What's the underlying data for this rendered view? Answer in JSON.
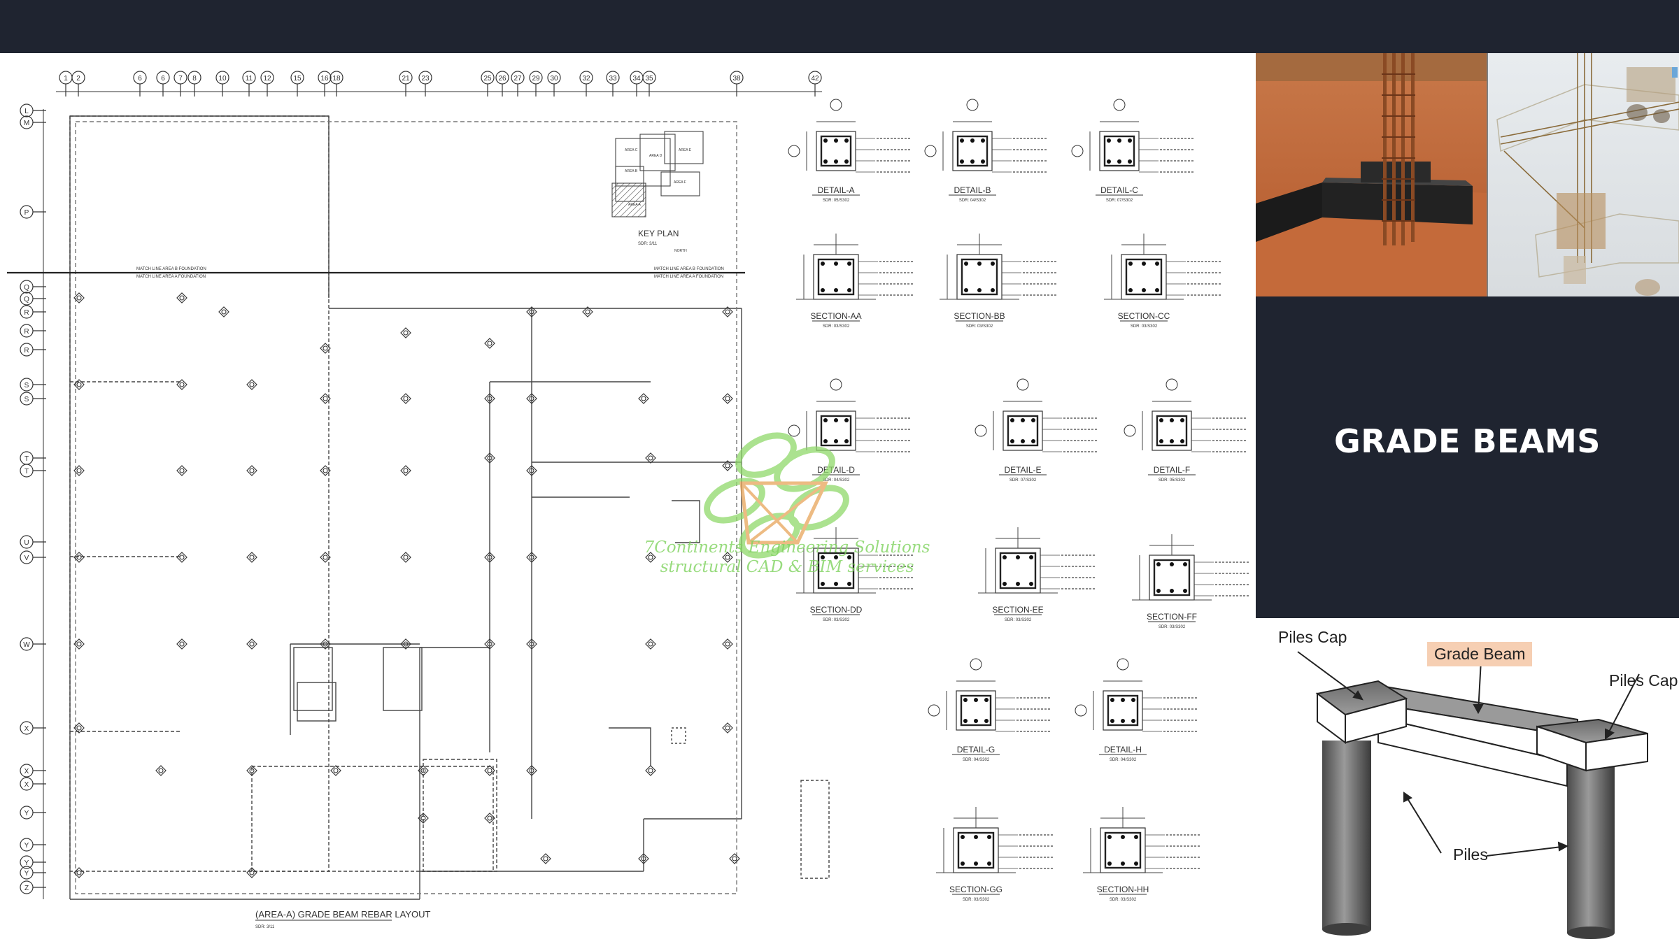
{
  "title": "GRADE BEAMS",
  "plan": {
    "top_grid_labels": [
      "1",
      "2",
      "6",
      "6",
      "7",
      "8",
      "10",
      "11",
      "12",
      "15",
      "16",
      "18",
      "21",
      "23",
      "25",
      "26",
      "27",
      "29",
      "30",
      "32",
      "33",
      "34",
      "35",
      "38",
      "42"
    ],
    "left_grid_labels": [
      "L",
      "M",
      "P",
      "Q",
      "Q",
      "R",
      "R",
      "R",
      "S",
      "S",
      "T",
      "T",
      "U",
      "V",
      "W",
      "X",
      "X",
      "X",
      "Y",
      "Y",
      "Y",
      "Y",
      "Z"
    ],
    "key_plan": {
      "title": "KEY PLAN",
      "ref": "SDR: 3/11",
      "areas": [
        "AREA C",
        "AREA D",
        "AREA E",
        "AREA B",
        "AREA F",
        "AREA A"
      ],
      "north": "NORTH"
    },
    "match_line_left": [
      "MATCH LINE AREA B FOUNDATION",
      "MATCH LINE AREA A FOUNDATION"
    ],
    "match_line_right": [
      "MATCH LINE AREA B FOUNDATION",
      "MATCH LINE AREA A FOUNDATION"
    ],
    "caption": "(AREA-A) GRADE BEAM REBAR LAYOUT",
    "caption_ref": "SDR: 3/11"
  },
  "details": [
    {
      "name": "DETAIL-A",
      "ref": "SDR: 05/S302"
    },
    {
      "name": "DETAIL-B",
      "ref": "SDR: 04/S302"
    },
    {
      "name": "DETAIL-C",
      "ref": "SDR: 07/S302"
    },
    {
      "name": "SECTION-AA",
      "ref": "SDR: 03/S302"
    },
    {
      "name": "SECTION-BB",
      "ref": "SDR: 03/S302"
    },
    {
      "name": "SECTION-CC",
      "ref": "SDR: 03/S302"
    },
    {
      "name": "DETAIL-D",
      "ref": "SDR: 04/S302"
    },
    {
      "name": "DETAIL-E",
      "ref": "SDR: 07/S302"
    },
    {
      "name": "DETAIL-F",
      "ref": "SDR: 05/S302"
    },
    {
      "name": "SECTION-DD",
      "ref": "SDR: 03/S302"
    },
    {
      "name": "SECTION-EE",
      "ref": "SDR: 03/S302"
    },
    {
      "name": "SECTION-FF",
      "ref": "SDR: 03/S302"
    },
    {
      "name": "DETAIL-G",
      "ref": "SDR: 04/S302"
    },
    {
      "name": "DETAIL-H",
      "ref": "SDR: 04/S302"
    },
    {
      "name": "SECTION-GG",
      "ref": "SDR: 03/S302"
    },
    {
      "name": "SECTION-HH",
      "ref": "SDR: 03/S302"
    }
  ],
  "watermark": {
    "line1": "7Continents Engineering Solutions",
    "line2": "structural CAD & BIM services"
  },
  "diagram": {
    "labels": {
      "piles_cap_left": "Piles Cap",
      "grade_beam": "Grade Beam",
      "piles_cap_right": "Piles Cap",
      "piles": "Piles"
    }
  },
  "colors": {
    "dark_panel": "#1f2430",
    "title_text": "#ffffff",
    "grade_beam_label_bg": "#f6cfb3",
    "watermark_green": "#7fd35e",
    "watermark_orange": "#e8a55a"
  }
}
